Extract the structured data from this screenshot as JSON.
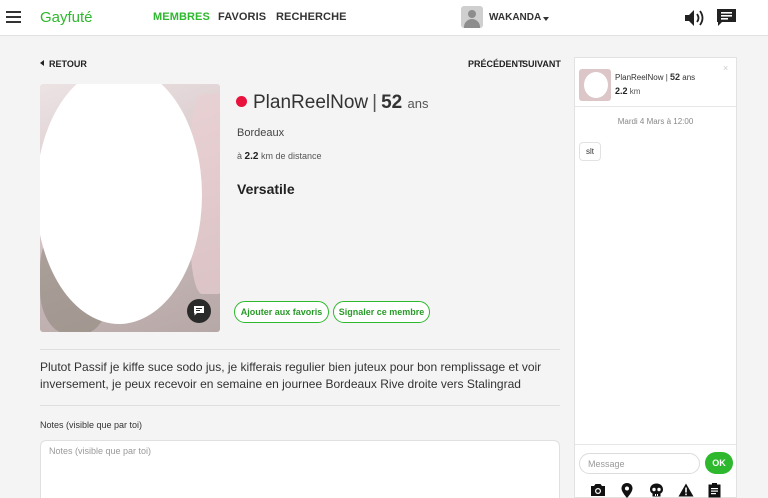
{
  "header": {
    "brand": "Gayfuté",
    "nav": [
      {
        "label": "MEMBRES",
        "active": true
      },
      {
        "label": "FAVORIS",
        "active": false
      },
      {
        "label": "RECHERCHE",
        "active": false
      }
    ],
    "user_name": "WAKANDA",
    "accent_color": "#2db82d"
  },
  "navigation": {
    "back": "RETOUR",
    "previous": "PRÉCÉDENT",
    "next": "SUIVANT"
  },
  "profile": {
    "name": "PlanReelNow",
    "separator": "|",
    "age": "52",
    "age_unit": "ans",
    "city": "Bordeaux",
    "distance_prefix": "à",
    "distance_value": "2.2",
    "distance_suffix": "km de distance",
    "role": "Versatile",
    "status_color": "#e8123c",
    "add_favorite": "Ajouter aux favoris",
    "report": "Signaler ce membre",
    "bio": "Plutot Passif je kiffe suce sodo jus, je kifferais regulier bien juteux pour bon remplissage et voir inversement, je peux recevoir en semaine en journee Bordeaux Rive droite vers Stalingrad"
  },
  "notes": {
    "label": "Notes (visible que par toi)",
    "placeholder": "Notes (visible que par toi)"
  },
  "chat": {
    "header_name": "PlanReelNow",
    "header_separator": "|",
    "header_age": "52",
    "header_age_unit": "ans",
    "header_distance": "2.2",
    "header_distance_unit": "km",
    "close": "×",
    "date": "Mardi 4 Mars à 12:00",
    "messages": [
      {
        "text": "slt"
      }
    ],
    "input_placeholder": "Message",
    "send_label": "OK",
    "tools": [
      "camera-icon",
      "location-pin-icon",
      "skull-icon",
      "warning-icon",
      "clipboard-icon"
    ]
  }
}
